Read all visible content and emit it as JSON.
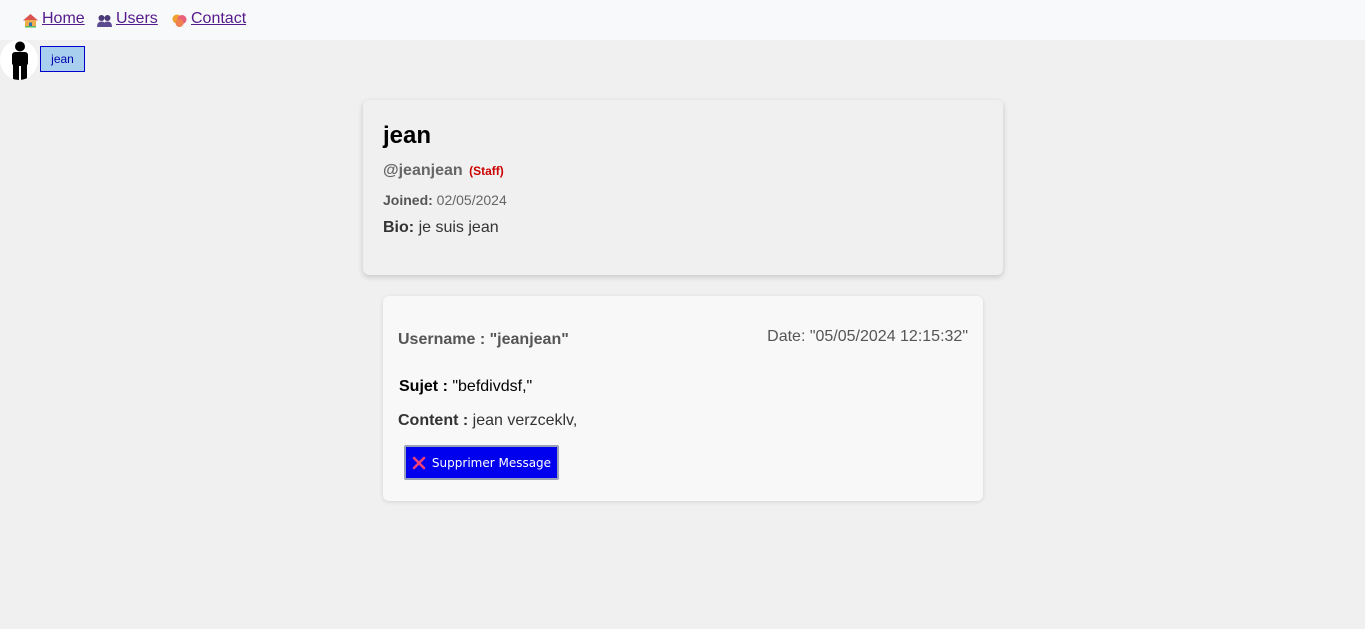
{
  "nav": {
    "items": [
      {
        "label": "Home",
        "icon": "house-icon"
      },
      {
        "label": "Users",
        "icon": "users-icon"
      },
      {
        "label": "Contact",
        "icon": "contact-icon"
      }
    ]
  },
  "user_menu": {
    "avatar_icon": "person-icon",
    "username": "jean"
  },
  "profile": {
    "name": "jean",
    "handle": "@jeanjean",
    "role": "(Staff)",
    "joined_label": "Joined:",
    "joined_date": "02/05/2024",
    "bio_label": "Bio:",
    "bio": "je suis jean"
  },
  "message": {
    "username_text": "Username : \"jeanjean\"",
    "date_text": "Date: \"05/05/2024 12:15:32\"",
    "subject_label": "Sujet :",
    "subject": "\"befdivdsf,\"",
    "content_label": "Content :",
    "content": "jean verzceklv,",
    "delete_label": "Supprimer Message"
  },
  "colors": {
    "link": "#551a8b",
    "staff": "#cc0000",
    "delete_button": "#0000ee",
    "page_background": "#f0f0f0"
  }
}
